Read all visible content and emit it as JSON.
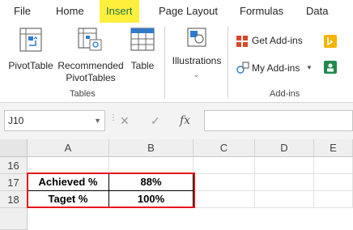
{
  "menu": {
    "tabs": [
      {
        "label": "File"
      },
      {
        "label": "Home"
      },
      {
        "label": "Insert",
        "active": true
      },
      {
        "label": "Page Layout"
      },
      {
        "label": "Formulas"
      },
      {
        "label": "Data"
      }
    ]
  },
  "ribbon": {
    "tables_group": {
      "label": "Tables",
      "pivot_table": "PivotTable",
      "recommended_line1": "Recommended",
      "recommended_line2": "PivotTables",
      "table": "Table"
    },
    "illustrations": "Illustrations",
    "addins_group": {
      "label": "Add-ins",
      "get_addins": "Get Add-ins",
      "my_addins": "My Add-ins"
    }
  },
  "formula_bar": {
    "name_box": "J10",
    "cancel_symbol": "✕",
    "enter_symbol": "✓",
    "fx_symbol": "fx",
    "formula": ""
  },
  "sheet": {
    "columns": [
      "A",
      "B",
      "C",
      "D",
      "E"
    ],
    "rows": [
      {
        "number": "16",
        "cells": [
          "",
          "",
          "",
          "",
          ""
        ]
      },
      {
        "number": "17",
        "cells": [
          "Achieved %",
          "88%",
          "",
          "",
          ""
        ]
      },
      {
        "number": "18",
        "cells": [
          "Taget %",
          "100%",
          "",
          "",
          ""
        ]
      }
    ]
  },
  "colors": {
    "active_tab_highlight": "#ffef3d",
    "excel_green": "#217346",
    "highlight_border": "#e8141b"
  }
}
